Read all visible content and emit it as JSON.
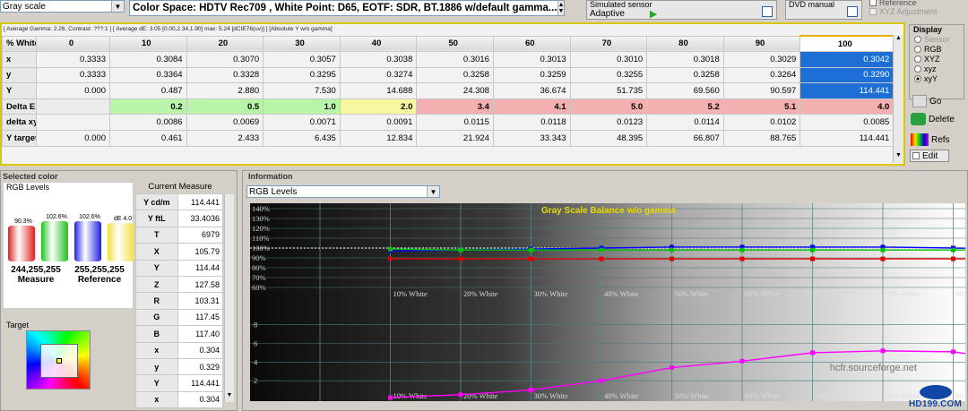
{
  "toolbar": {
    "measure_mode": "Gray scale",
    "colorspace_text": "Color Space: HDTV Rec709 , White Point: D65, EOTF:  SDR, BT.1886 w/default gamma...",
    "sensor_label": "Simulated sensor",
    "sensor_value": "Adaptive",
    "generator_label": "DVD manual",
    "reference_label": "Reference",
    "xyz_adjust_label": "XYZ Adjustment"
  },
  "summary_line": "[ Average Gamma: 2.26, Contrast: ???:1 ] [ Average dE: 3.05 [0.00,2.34,1.90] max: 5.24 [dCIE76(uv)] ] [Absolute Y w/o gamma]",
  "table": {
    "corner": "% White",
    "columns": [
      "0",
      "10",
      "20",
      "30",
      "40",
      "50",
      "60",
      "70",
      "80",
      "90",
      "100"
    ],
    "rows": [
      {
        "label": "x",
        "values": [
          "0.3333",
          "0.3084",
          "0.3070",
          "0.3057",
          "0.3038",
          "0.3016",
          "0.3013",
          "0.3010",
          "0.3018",
          "0.3029",
          "0.3042"
        ]
      },
      {
        "label": "y",
        "values": [
          "0.3333",
          "0.3364",
          "0.3328",
          "0.3295",
          "0.3274",
          "0.3258",
          "0.3259",
          "0.3255",
          "0.3258",
          "0.3264",
          "0.3290"
        ]
      },
      {
        "label": "Y",
        "values": [
          "0.000",
          "0.487",
          "2.880",
          "7.530",
          "14.688",
          "24.308",
          "36.674",
          "51.735",
          "69.560",
          "90.597",
          "114.441"
        ]
      },
      {
        "label": "Delta E",
        "values": [
          "",
          "0.2",
          "0.5",
          "1.0",
          "2.0",
          "3.4",
          "4.1",
          "5.0",
          "5.2",
          "5.1",
          "4.0"
        ]
      },
      {
        "label": "delta xy",
        "values": [
          "",
          "0.0086",
          "0.0069",
          "0.0071",
          "0.0091",
          "0.0115",
          "0.0118",
          "0.0123",
          "0.0114",
          "0.0102",
          "0.0085"
        ]
      },
      {
        "label": "Y target",
        "values": [
          "0.000",
          "0.461",
          "2.433",
          "6.435",
          "12.834",
          "21.924",
          "33.343",
          "48.395",
          "66.807",
          "88.765",
          "114.441"
        ]
      }
    ]
  },
  "display": {
    "title": "Display",
    "options": [
      "Sensor",
      "RGB",
      "XYZ",
      "xyz",
      "xyY"
    ],
    "selected": "xyY",
    "go_label": "Go",
    "delete_label": "Delete",
    "refs_label": "Refs",
    "edit_label": "Edit"
  },
  "selected_color": {
    "title": "Selected color",
    "rgb_levels_label": "RGB Levels",
    "bars": [
      {
        "label": "90.3%",
        "level": 0.903,
        "color": "#e02020"
      },
      {
        "label": "102.6%",
        "level": 1.026,
        "color": "#20c020"
      },
      {
        "label": "102.6%",
        "level": 1.026,
        "color": "#2020e0"
      },
      {
        "label": "dE 4.0",
        "level": 0.98,
        "color": "#f0e040"
      }
    ],
    "measure_value": "244,255,255",
    "measure_label": "Measure",
    "reference_value": "255,255,255",
    "reference_label": "Reference",
    "target_label": "Target"
  },
  "current_measure": {
    "title": "Current Measure",
    "rows": [
      {
        "k": "Y cd/m",
        "v": "114.441"
      },
      {
        "k": "Y ftL",
        "v": "33.4036"
      },
      {
        "k": "T",
        "v": "6979"
      },
      {
        "k": "X",
        "v": "105.79"
      },
      {
        "k": "Y",
        "v": "114.44"
      },
      {
        "k": "Z",
        "v": "127.58"
      },
      {
        "k": "R",
        "v": "103.31"
      },
      {
        "k": "G",
        "v": "117.45"
      },
      {
        "k": "B",
        "v": "117.40"
      },
      {
        "k": "x",
        "v": "0.304"
      },
      {
        "k": "y",
        "v": "0.329"
      },
      {
        "k": "Y",
        "v": "114.441"
      },
      {
        "k": "x",
        "v": "0.304"
      }
    ]
  },
  "information": {
    "title": "Information",
    "view_select": "RGB Levels"
  },
  "chart_data": {
    "type": "line",
    "title": "Gray Scale Balance w/o gamma",
    "x_tick_labels": [
      "10% White",
      "20% White",
      "30% White",
      "40% White",
      "50% White",
      "60% White",
      "70% White",
      "80% White",
      "90% White"
    ],
    "top": {
      "y_tick_labels": [
        "140%",
        "130%",
        "120%",
        "110%",
        "100%",
        "90%",
        "80%",
        "70%",
        "60%"
      ],
      "ylim": [
        60,
        140
      ],
      "x": [
        0,
        10,
        20,
        30,
        40,
        50,
        60,
        70,
        80,
        90,
        100
      ],
      "series": [
        {
          "color": "#0000ff",
          "values": [
            97,
            97,
            98,
            99,
            100,
            101,
            101,
            101,
            101,
            100,
            99
          ]
        },
        {
          "color": "#00c000",
          "values": [
            99,
            99,
            98,
            98,
            98,
            98,
            98,
            98,
            98,
            98,
            98
          ]
        },
        {
          "color": "#e00000",
          "values": [
            89,
            89,
            89,
            89,
            89,
            89,
            89,
            89,
            89,
            89,
            89
          ]
        }
      ]
    },
    "bottom": {
      "y_tick_labels": [
        "8",
        "6",
        "4",
        "2"
      ],
      "ylim": [
        0,
        9.6
      ],
      "x": [
        0,
        10,
        20,
        30,
        40,
        50,
        60,
        70,
        80,
        90,
        100
      ],
      "series": [
        {
          "color": "#ff00ff",
          "values": [
            0,
            0.2,
            0.5,
            1.0,
            2.0,
            3.4,
            4.1,
            5.0,
            5.2,
            5.1,
            4.0
          ]
        }
      ]
    },
    "watermark": "hcfr.sourceforge.net"
  },
  "logo_text": "HD199.COM"
}
